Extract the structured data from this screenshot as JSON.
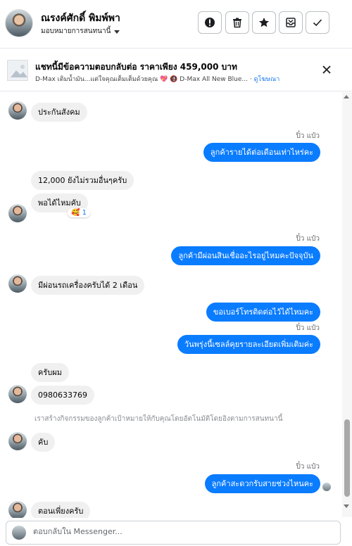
{
  "header": {
    "contact_name": "ณรงค์ศักดิ์ พิมพ์พา",
    "assign_label": "มอบหมายการสนทนานี้"
  },
  "banner": {
    "title": "แชทนี้มีข้อความตอบกลับต่อ ราคาเพียง 459,000 บาท",
    "subtitle": "D-Max เติมน้ำมัน...แต่ใจคุณเต็มเต็มด้วยคุณ 💖 🚯 D-Max All New Blue... ·",
    "link": "ดูโฆษณา"
  },
  "messages": {
    "m1": "ประกันสังคม",
    "s1": "ปิ๋ว แป๋ว",
    "m2": "ลูกค้ารายได้ต่อเดือนเท่าไหร่คะ",
    "m3": "12,000 ยังไม่รวมอื่นๆครับ",
    "m4": "พอได้ไหมคับ",
    "reaction": "🥰 1",
    "s2": "ปิ๋ว แป๋ว",
    "m5": "ลูกค้ามีผ่อนสินเชื่ออะไรอยู่ไหมคะปัจจุบัน",
    "m6": "มีผ่อนรถเครื่องครับได้ 2 เดือน",
    "m7": "ขอเบอร์โทรติดต่อไว้ได้ไหมคะ",
    "s3": "ปิ๋ว แป๋ว",
    "m8": "วันพรุ่งนี้เซลล์คุยรายละเอียดเพิ่มเติมค่ะ",
    "m9": "ครับผม",
    "m10": "0980633769",
    "system": "เราสร้างกิจกรรมของลูกค้าเป้าหมายให้กับคุณโดยอัตโนมัติโดยอิงตามการสนทนานี้",
    "m11": "คับ",
    "s4": "ปิ๋ว แป๋ว",
    "m12": "ลูกค้าสะดวกรับสายช่วงไหนคะ",
    "m13": "ตอนเพี่ยงครับ"
  },
  "composer": {
    "placeholder": "ตอบกลับใน Messenger..."
  },
  "colors": {
    "outgoing_bubble": "#0a7cff",
    "incoming_bubble": "#f0f0f0",
    "link": "#1877f2"
  },
  "icons": [
    "alert-icon",
    "trash-icon",
    "star-icon",
    "inbox-icon",
    "check-icon",
    "close-icon",
    "caret-down-icon"
  ]
}
